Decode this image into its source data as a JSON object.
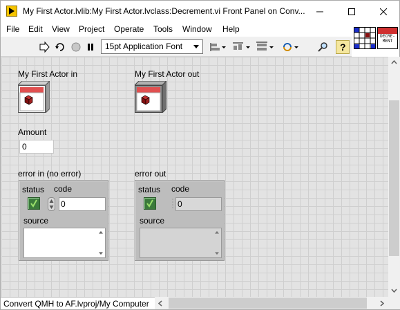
{
  "window": {
    "title": "My First Actor.lvlib:My First Actor.lvclass:Decrement.vi Front Panel on Conv..."
  },
  "menu": [
    "File",
    "Edit",
    "View",
    "Project",
    "Operate",
    "Tools",
    "Window",
    "Help"
  ],
  "toolbar": {
    "font": "15pt Application Font"
  },
  "vi_icon": {
    "label": "DECRE-\nMENT"
  },
  "panel": {
    "actor_in_label": "My First Actor in",
    "actor_out_label": "My First Actor out",
    "amount_label": "Amount",
    "amount_value": "0",
    "error_in": {
      "label": "error in (no error)",
      "status_label": "status",
      "code_label": "code",
      "code_value": "0",
      "source_label": "source",
      "source_value": ""
    },
    "error_out": {
      "label": "error out",
      "status_label": "status",
      "code_label": "code",
      "code_value": "0",
      "source_label": "source",
      "source_value": ""
    }
  },
  "statusbar": {
    "context": "Convert QMH to AF.lvproj/My Computer"
  },
  "colors": {
    "led_green": "#3b7a3b",
    "check_green": "#9be06a",
    "object_red": "#e05050"
  }
}
